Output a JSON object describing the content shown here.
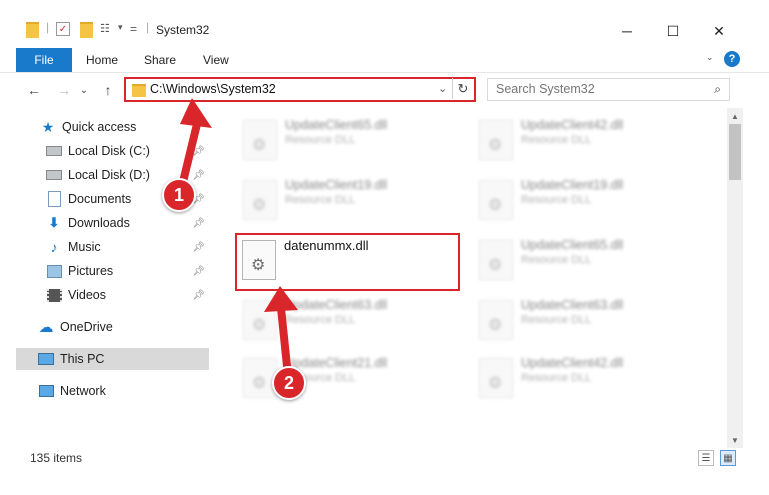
{
  "window": {
    "title": "System32",
    "minimize": "─",
    "maximize": "☐",
    "close": "✕"
  },
  "ribbon": {
    "tabs": [
      "File",
      "Home",
      "Share",
      "View"
    ],
    "help": "?"
  },
  "navbar": {
    "back": "←",
    "forward": "→",
    "recent": "⌄",
    "up": "↑",
    "address": "C:\\Windows\\System32",
    "refresh": "↻",
    "dropdown": "⌄"
  },
  "search": {
    "placeholder": "Search System32"
  },
  "sidebar": {
    "items": [
      {
        "label": "Quick access",
        "icon": "star-icon",
        "pinned": false
      },
      {
        "label": "Local Disk (C:)",
        "icon": "drive-icon",
        "pinned": true
      },
      {
        "label": "Local Disk (D:)",
        "icon": "drive-icon",
        "pinned": true
      },
      {
        "label": "Documents",
        "icon": "document-icon",
        "pinned": true
      },
      {
        "label": "Downloads",
        "icon": "download-icon",
        "pinned": true
      },
      {
        "label": "Music",
        "icon": "music-icon",
        "pinned": true
      },
      {
        "label": "Pictures",
        "icon": "picture-icon",
        "pinned": true
      },
      {
        "label": "Videos",
        "icon": "video-icon",
        "pinned": true
      },
      {
        "label": "OneDrive",
        "icon": "cloud-icon",
        "pinned": false
      },
      {
        "label": "This PC",
        "icon": "computer-icon",
        "pinned": false,
        "selected": true
      },
      {
        "label": "Network",
        "icon": "network-icon",
        "pinned": false
      }
    ]
  },
  "files": {
    "left_column": [
      {
        "name": "UpdateClient65.dll",
        "type": "Resource DLL"
      },
      {
        "name": "UpdateClient19.dll",
        "type": "Resource DLL"
      },
      {
        "name": "datenummx.dll",
        "type": ""
      },
      {
        "name": "UpdateClient63.dll",
        "type": "Resource DLL"
      },
      {
        "name": "UpdateClient21.dll",
        "type": "Resource DLL"
      }
    ],
    "right_column": [
      {
        "name": "UpdateClient42.dll",
        "type": "Resource DLL"
      },
      {
        "name": "UpdateClient19.dll",
        "type": "Resource DLL"
      },
      {
        "name": "UpdateClient65.dll",
        "type": "Resource DLL"
      },
      {
        "name": "UpdateClient63.dll",
        "type": "Resource DLL"
      },
      {
        "name": "UpdateClient42.dll",
        "type": "Resource DLL"
      }
    ]
  },
  "status": {
    "item_count": "135 items"
  },
  "callouts": {
    "step1": "1",
    "step2": "2"
  },
  "colors": {
    "accent": "#1979ca",
    "highlight": "#d9262b"
  }
}
